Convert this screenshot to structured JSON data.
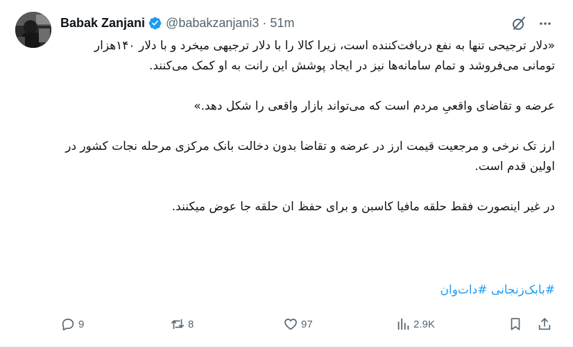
{
  "author": {
    "name": "Babak Zanjani",
    "handle": "@babakzanjani3",
    "separator": "·",
    "time": "51m",
    "verified": true
  },
  "tweet": {
    "paragraphs": [
      "«دلار ترجیحی تنها به نفع دریافت‌کننده است، زیرا کالا را با دلار ترجیهی میخرد و با دلار ۱۴۰هزار تومانی می‌فروشد و تمام سامانه‌ها نیز در ایجاد پوشش این رانت به او کمک می‌کنند.",
      "عرضه و تقاضای واقعیِ مردم است که می‌تواند بازار واقعی را شکل دهد.»",
      "ارز تک نرخی و مرجعیت قیمت ارز در عرضه و تقاضا بدون دخالت بانک مرکزی مرحله نجات کشور در اولین قدم است.",
      "در غیر اینصورت فقط حلقه مافیا کاسبن و برای حفظ ان حلقه جا عوض میکنند."
    ],
    "hashtags": [
      "#بابک‌زنجانی",
      "#دات‌وان"
    ]
  },
  "actions": {
    "replies": "9",
    "reposts": "8",
    "likes": "97",
    "views": "2.9K"
  },
  "icons": {
    "header": [
      "grok-icon",
      "more-icon"
    ],
    "actions": [
      "reply-icon",
      "repost-icon",
      "like-icon",
      "views-icon",
      "bookmark-icon",
      "share-icon"
    ]
  },
  "colors": {
    "text": "#0f1419",
    "secondary": "#536471",
    "link": "#1d9bf0",
    "verified": "#1d9bf0"
  }
}
